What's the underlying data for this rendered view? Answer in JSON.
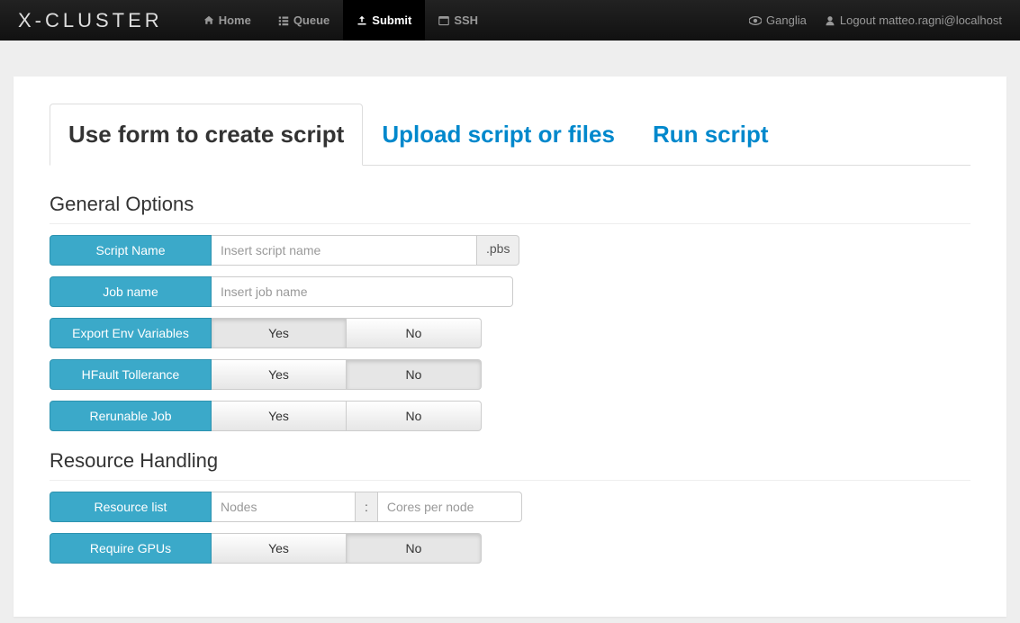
{
  "brand": "X-CLUSTER",
  "nav": {
    "home": "Home",
    "queue": "Queue",
    "submit": "Submit",
    "ssh": "SSH"
  },
  "navRight": {
    "ganglia": "Ganglia",
    "logout": "Logout matteo.ragni@localhost"
  },
  "tabs": {
    "form": "Use form to create script",
    "upload": "Upload script or files",
    "run": "Run script"
  },
  "sections": {
    "general": "General Options",
    "resource": "Resource Handling"
  },
  "fields": {
    "scriptName": {
      "label": "Script Name",
      "placeholder": "Insert script name",
      "suffix": ".pbs"
    },
    "jobName": {
      "label": "Job name",
      "placeholder": "Insert job name"
    },
    "exportEnv": {
      "label": "Export Env Variables",
      "yes": "Yes",
      "no": "No",
      "selected": "yes"
    },
    "hfault": {
      "label": "HFault Tollerance",
      "yes": "Yes",
      "no": "No",
      "selected": "no"
    },
    "rerunable": {
      "label": "Rerunable Job",
      "yes": "Yes",
      "no": "No",
      "selected": ""
    },
    "resourceList": {
      "label": "Resource list",
      "nodesPlaceholder": "Nodes",
      "coresPlaceholder": "Cores per node",
      "sep": ":"
    },
    "requireGpus": {
      "label": "Require GPUs",
      "yes": "Yes",
      "no": "No",
      "selected": "no"
    }
  }
}
